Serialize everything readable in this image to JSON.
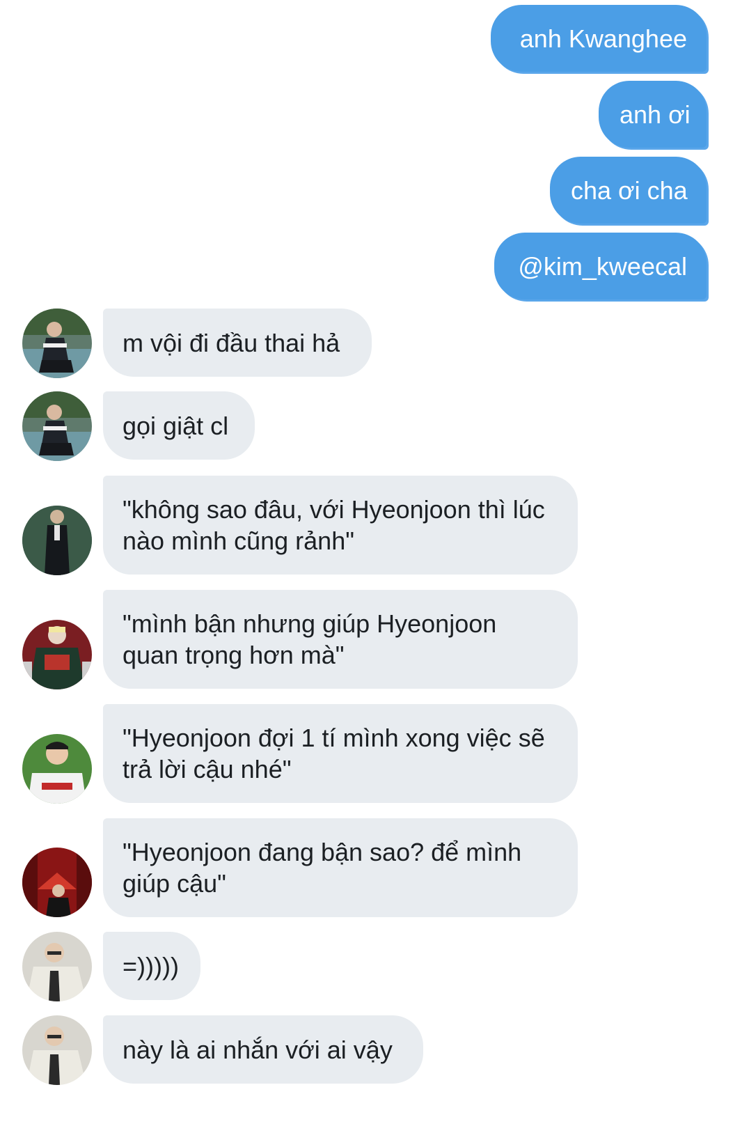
{
  "sent_messages": [
    {
      "text": "anh Kwanghee"
    },
    {
      "text": "anh ơi"
    },
    {
      "text": "cha ơi cha"
    },
    {
      "text": "@kim_kweecal"
    }
  ],
  "received_messages": [
    {
      "text": "m vội đi đầu thai hả"
    },
    {
      "text": "gọi giật cl"
    },
    {
      "text": "\"không sao đâu, với Hyeonjoon thì lúc nào mình cũng rảnh\""
    },
    {
      "text": "\"mình bận nhưng giúp Hyeonjoon quan trọng hơn mà\""
    },
    {
      "text": "\"Hyeonjoon đợi 1 tí mình xong việc sẽ trả lời cậu nhé\""
    },
    {
      "text": "\"Hyeonjoon đang bận sao? để mình giúp cậu\""
    },
    {
      "text": "=)))))"
    },
    {
      "text": "này là ai nhắn với ai vậy"
    }
  ],
  "colors": {
    "sent_bubble": "#4b9ee6",
    "received_bubble": "#e8ecf0",
    "received_text": "#1b1f23"
  }
}
